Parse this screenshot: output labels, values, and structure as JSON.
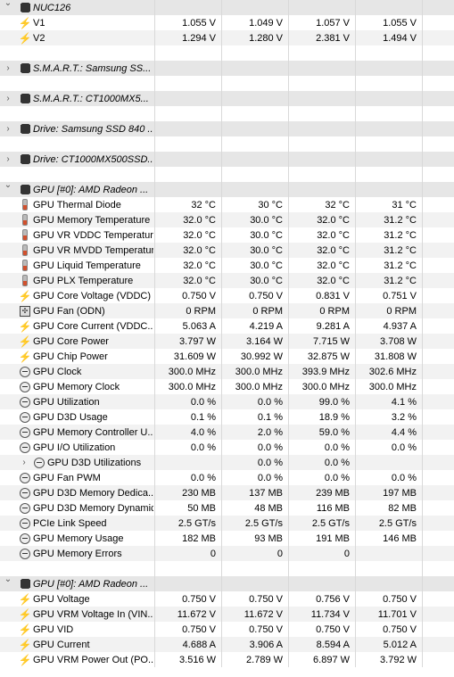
{
  "sections": [
    {
      "title": "NUC126",
      "expanded": true,
      "icon": "chip-icon",
      "rows": [
        {
          "name": "V1",
          "icon": "bolt-icon",
          "v": [
            "1.055 V",
            "1.049 V",
            "1.057 V",
            "1.055 V"
          ]
        },
        {
          "name": "V2",
          "icon": "bolt-icon",
          "v": [
            "1.294 V",
            "1.280 V",
            "2.381 V",
            "1.494 V"
          ]
        }
      ]
    },
    {
      "title": "S.M.A.R.T.: Samsung SS...",
      "expanded": false,
      "icon": "chip-icon",
      "rows": []
    },
    {
      "title": "S.M.A.R.T.: CT1000MX5...",
      "expanded": false,
      "icon": "chip-icon",
      "rows": []
    },
    {
      "title": "Drive: Samsung SSD 840 ...",
      "expanded": false,
      "icon": "chip-icon",
      "rows": []
    },
    {
      "title": "Drive: CT1000MX500SSD...",
      "expanded": false,
      "icon": "chip-icon",
      "rows": []
    },
    {
      "title": "GPU [#0]: AMD Radeon ...",
      "expanded": true,
      "icon": "chip-icon",
      "rows": [
        {
          "name": "GPU Thermal Diode",
          "icon": "thermometer-icon",
          "v": [
            "32 °C",
            "30 °C",
            "32 °C",
            "31 °C"
          ]
        },
        {
          "name": "GPU Memory Temperature",
          "icon": "thermometer-icon",
          "v": [
            "32.0 °C",
            "30.0 °C",
            "32.0 °C",
            "31.2 °C"
          ]
        },
        {
          "name": "GPU VR VDDC Temperature",
          "icon": "thermometer-icon",
          "v": [
            "32.0 °C",
            "30.0 °C",
            "32.0 °C",
            "31.2 °C"
          ]
        },
        {
          "name": "GPU VR MVDD Temperature",
          "icon": "thermometer-icon",
          "v": [
            "32.0 °C",
            "30.0 °C",
            "32.0 °C",
            "31.2 °C"
          ]
        },
        {
          "name": "GPU Liquid Temperature",
          "icon": "thermometer-icon",
          "v": [
            "32.0 °C",
            "30.0 °C",
            "32.0 °C",
            "31.2 °C"
          ]
        },
        {
          "name": "GPU PLX Temperature",
          "icon": "thermometer-icon",
          "v": [
            "32.0 °C",
            "30.0 °C",
            "32.0 °C",
            "31.2 °C"
          ]
        },
        {
          "name": "GPU Core Voltage (VDDC)",
          "icon": "bolt-icon",
          "v": [
            "0.750 V",
            "0.750 V",
            "0.831 V",
            "0.751 V"
          ]
        },
        {
          "name": "GPU Fan (ODN)",
          "icon": "fan-icon",
          "v": [
            "0 RPM",
            "0 RPM",
            "0 RPM",
            "0 RPM"
          ]
        },
        {
          "name": "GPU Core Current (VDDC...",
          "icon": "bolt-icon",
          "v": [
            "5.063 A",
            "4.219 A",
            "9.281 A",
            "4.937 A"
          ]
        },
        {
          "name": "GPU Core Power",
          "icon": "bolt-icon",
          "v": [
            "3.797 W",
            "3.164 W",
            "7.715 W",
            "3.708 W"
          ]
        },
        {
          "name": "GPU Chip Power",
          "icon": "bolt-icon",
          "v": [
            "31.609 W",
            "30.992 W",
            "32.875 W",
            "31.808 W"
          ]
        },
        {
          "name": "GPU Clock",
          "icon": "gauge-icon",
          "v": [
            "300.0 MHz",
            "300.0 MHz",
            "393.9 MHz",
            "302.6 MHz"
          ]
        },
        {
          "name": "GPU Memory Clock",
          "icon": "gauge-icon",
          "v": [
            "300.0 MHz",
            "300.0 MHz",
            "300.0 MHz",
            "300.0 MHz"
          ]
        },
        {
          "name": "GPU Utilization",
          "icon": "gauge-icon",
          "v": [
            "0.0 %",
            "0.0 %",
            "99.0 %",
            "4.1 %"
          ]
        },
        {
          "name": "GPU D3D Usage",
          "icon": "gauge-icon",
          "v": [
            "0.1 %",
            "0.1 %",
            "18.9 %",
            "3.2 %"
          ]
        },
        {
          "name": "GPU Memory Controller U...",
          "icon": "gauge-icon",
          "v": [
            "4.0 %",
            "2.0 %",
            "59.0 %",
            "4.4 %"
          ]
        },
        {
          "name": "GPU I/O Utilization",
          "icon": "gauge-icon",
          "v": [
            "0.0 %",
            "0.0 %",
            "0.0 %",
            "0.0 %"
          ]
        },
        {
          "name": "GPU D3D Utilizations",
          "icon": "gauge-icon",
          "sub": true,
          "v": [
            "",
            "0.0 %",
            "0.0 %",
            ""
          ]
        },
        {
          "name": "GPU Fan PWM",
          "icon": "gauge-icon",
          "v": [
            "0.0 %",
            "0.0 %",
            "0.0 %",
            "0.0 %"
          ]
        },
        {
          "name": "GPU D3D Memory Dedica...",
          "icon": "gauge-icon",
          "v": [
            "230 MB",
            "137 MB",
            "239 MB",
            "197 MB"
          ]
        },
        {
          "name": "GPU D3D Memory Dynamic",
          "icon": "gauge-icon",
          "v": [
            "50 MB",
            "48 MB",
            "116 MB",
            "82 MB"
          ]
        },
        {
          "name": "PCIe Link Speed",
          "icon": "gauge-icon",
          "v": [
            "2.5 GT/s",
            "2.5 GT/s",
            "2.5 GT/s",
            "2.5 GT/s"
          ]
        },
        {
          "name": "GPU Memory Usage",
          "icon": "gauge-icon",
          "v": [
            "182 MB",
            "93 MB",
            "191 MB",
            "146 MB"
          ]
        },
        {
          "name": "GPU Memory Errors",
          "icon": "gauge-icon",
          "v": [
            "0",
            "0",
            "0",
            ""
          ]
        }
      ]
    },
    {
      "title": "GPU [#0]: AMD Radeon ...",
      "expanded": true,
      "icon": "chip-icon",
      "rows": [
        {
          "name": "GPU Voltage",
          "icon": "bolt-icon",
          "v": [
            "0.750 V",
            "0.750 V",
            "0.756 V",
            "0.750 V"
          ]
        },
        {
          "name": "GPU VRM Voltage In (VIN...",
          "icon": "bolt-icon",
          "v": [
            "11.672 V",
            "11.672 V",
            "11.734 V",
            "11.701 V"
          ]
        },
        {
          "name": "GPU VID",
          "icon": "bolt-icon",
          "v": [
            "0.750 V",
            "0.750 V",
            "0.750 V",
            "0.750 V"
          ]
        },
        {
          "name": "GPU Current",
          "icon": "bolt-icon",
          "v": [
            "4.688 A",
            "3.906 A",
            "8.594 A",
            "5.012 A"
          ]
        },
        {
          "name": "GPU VRM Power Out (PO...",
          "icon": "bolt-icon",
          "v": [
            "3.516 W",
            "2.789 W",
            "6.897 W",
            "3.792 W"
          ]
        }
      ]
    }
  ]
}
